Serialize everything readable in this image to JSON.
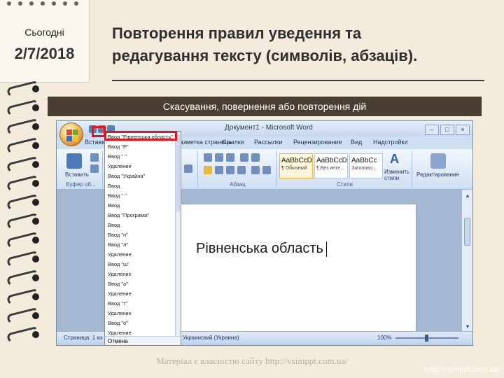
{
  "slide": {
    "date_label": "Сьогодні",
    "date": "2/7/2018",
    "title_line1": "Повторення правил уведення та",
    "title_line2": "редагування тексту (символів, абзаців).",
    "subtitle": "Скасування, повернення або повторення дій",
    "watermark": "Матеріал є власністю сайту http://vsimppt.com.ua/",
    "url": "http://vsimppt.com.ua/"
  },
  "word": {
    "window_title": "Документ1 - Microsoft Word",
    "window_buttons": [
      "–",
      "□",
      "×"
    ],
    "tabs": [
      "Вставка",
      "Разметка страницы",
      "Ссылки",
      "Рассылки",
      "Рецензирование",
      "Вид",
      "Надстройки"
    ],
    "ribbon": {
      "paste_label": "Вставить",
      "clipboard_group": "Буфер об...",
      "paragraph_group": "Абзац",
      "styles_group": "Стили",
      "styles": [
        {
          "sample": "AaBbCcDc",
          "name": "¶ Обычный"
        },
        {
          "sample": "AaBbCcDc",
          "name": "¶ Без инте..."
        },
        {
          "sample": "AaBbCc",
          "name": "Заголово..."
        }
      ],
      "change_styles": "Изменить стили",
      "editing": "Редактирование"
    },
    "document_text": "Рівненська область",
    "undo_list": [
      "Ввод \"Рівненська область\"",
      "Ввод \"Р\"",
      "Ввод \" \"",
      "Удаление",
      "Ввод \"Украйна\"",
      "Ввод",
      "Ввод \" \"",
      "Ввод",
      "Ввод \"Програма\"",
      "Ввод",
      "Ввод \"н\"",
      "Ввод \"л\"",
      "Удаление",
      "Ввод \"ш\"",
      "Удаление",
      "Ввод \"а\"",
      "Удаление",
      "Ввод \"т\"",
      "Удаление",
      "Ввод \"о\"",
      "Удаление"
    ],
    "undo_footer": "Отмена",
    "status_left": "Страница: 1 из 1",
    "status_lang": "Украинский (Украина)",
    "zoom": "100%"
  }
}
